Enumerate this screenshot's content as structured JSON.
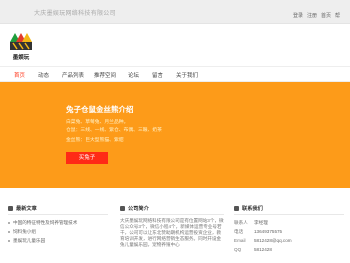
{
  "header": {
    "company": "大庆墨娱玩网络科技有限公司",
    "links": [
      "登录",
      "注册",
      "首页",
      "帮"
    ]
  },
  "logo": {
    "text": "墨娱玩"
  },
  "nav": {
    "items": [
      "首页",
      "动态",
      "产品列表",
      "推荐空间",
      "论坛",
      "留言",
      "关于我们"
    ],
    "active_index": 0,
    "active_color": "#ff3b1f"
  },
  "banner": {
    "bg_color": "#fd9b19",
    "title": "兔子仓鼠金丝熊介绍",
    "line1": "白菜兔、草莓兔、月兰品种。",
    "line2": "仓鼠：三线、一线、紫仓、布偶、三眼、奶茶",
    "line3": "金丝熊：巨大型熊猫、紫貂",
    "button": "买兔子",
    "button_color": "#ff2a16"
  },
  "news": {
    "title": "最新文章",
    "items": [
      "中国的特征特性及饲养管理技术",
      "饲料兔小组",
      "墨娱玩儿童乐园"
    ]
  },
  "about": {
    "title": "公司简介",
    "text": "大庆墨娱玩网络科技有限公司是有位置网站3个，微信公众号3个，微信小程4个，新媒体运营专业号若干，公司可以让东北赞助期机构运营投资企业，教育培训开发，进行网络营销生态服务。同时开设金兔儿童娱乐园，宠物养殖中心"
  },
  "contact": {
    "title": "联系我们",
    "rows": [
      {
        "key": "联系人",
        "value": "李经理"
      },
      {
        "key": "电话",
        "value": "13649375575"
      },
      {
        "key": "Email",
        "value": "5812428@qq.com"
      },
      {
        "key": "QQ",
        "value": "5812428"
      }
    ]
  }
}
